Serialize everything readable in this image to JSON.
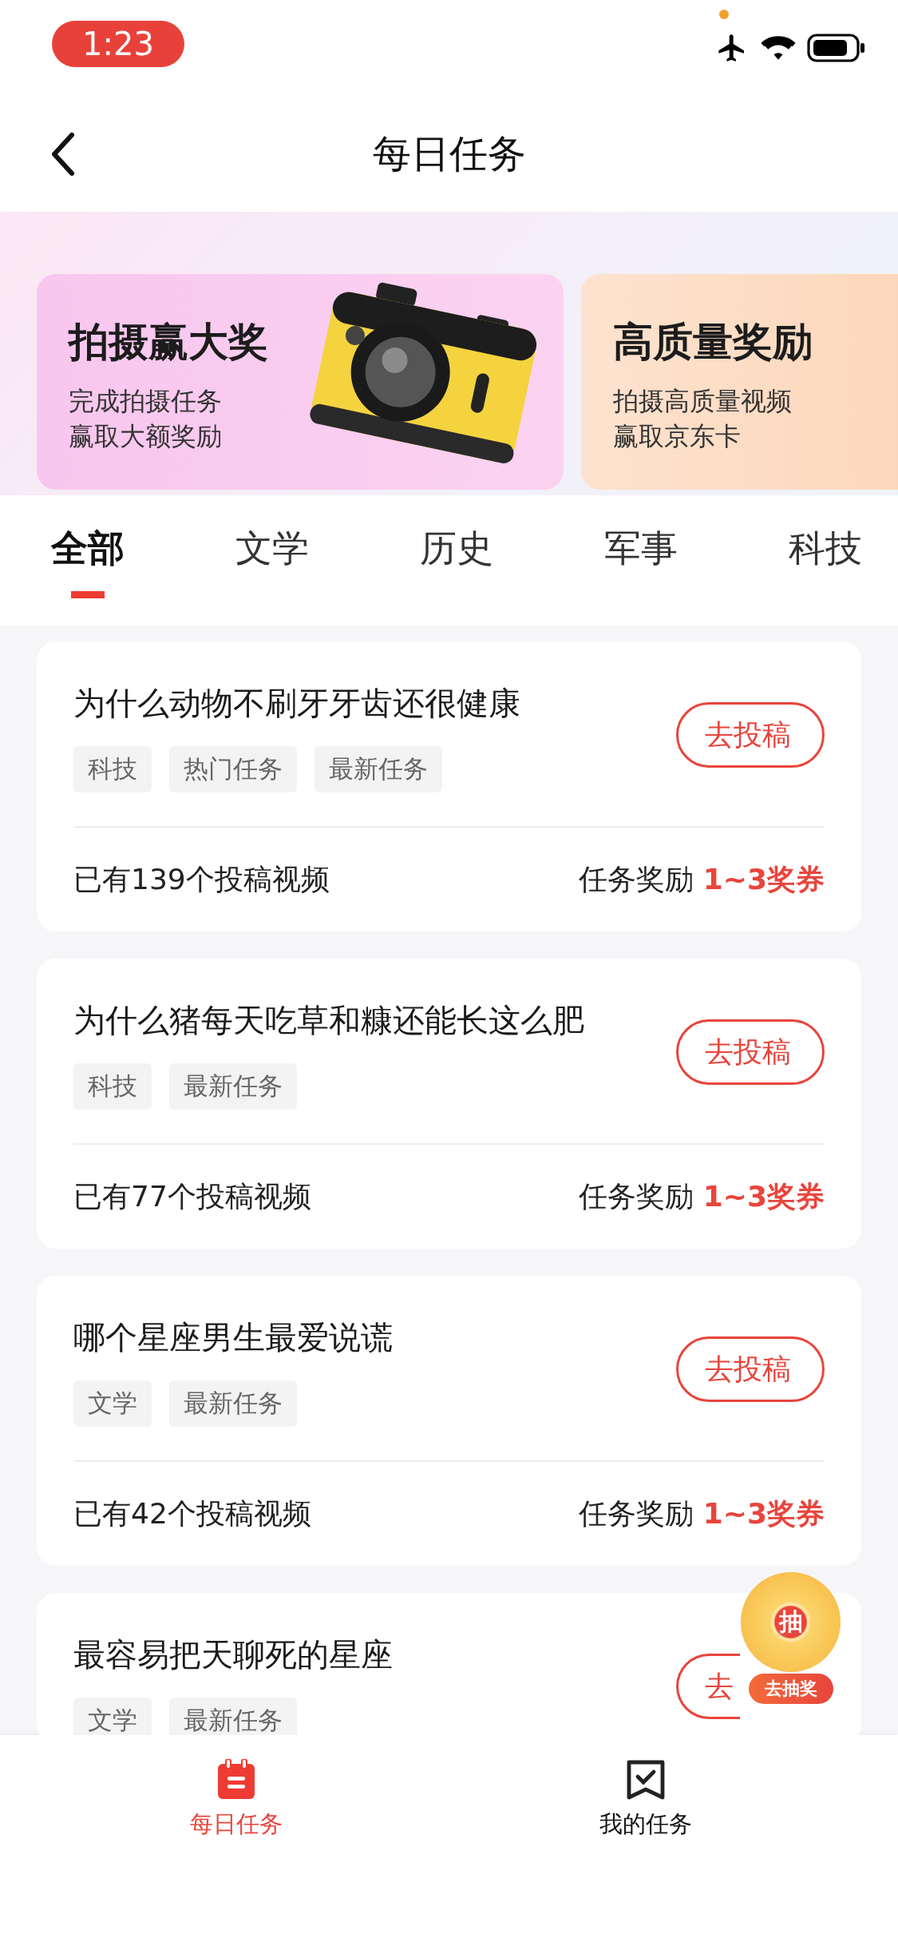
{
  "status_bar": {
    "time": "1:23"
  },
  "header": {
    "title": "每日任务"
  },
  "banners": [
    {
      "kind": "camera",
      "title": "拍摄赢大奖",
      "lines": [
        "完成拍摄任务",
        "赢取大额奖励"
      ]
    },
    {
      "kind": "card",
      "title": "高质量奖励",
      "lines": [
        "拍摄高质量视频",
        "赢取京东卡"
      ]
    }
  ],
  "tabs": [
    {
      "label": "全部",
      "selected": true
    },
    {
      "label": "文学",
      "selected": false
    },
    {
      "label": "历史",
      "selected": false
    },
    {
      "label": "军事",
      "selected": false
    },
    {
      "label": "科技",
      "selected": false
    }
  ],
  "tasks": [
    {
      "title": "为什么动物不刷牙牙齿还很健康",
      "tags": [
        "科技",
        "热门任务",
        "最新任务"
      ],
      "button": "去投稿",
      "count": "已有139个投稿视频",
      "reward": "任务奖励 **1~3奖券**"
    },
    {
      "title": "为什么猪每天吃草和糠还能长这么肥",
      "tags": [
        "科技",
        "最新任务"
      ],
      "button": "去投稿",
      "count": "已有77个投稿视频",
      "reward": "任务奖励 **1~3奖券**"
    },
    {
      "title": "哪个星座男生最爱说谎",
      "tags": [
        "文学",
        "最新任务"
      ],
      "button": "去投稿",
      "count": "已有42个投稿视频",
      "reward": "任务奖励 **1~3奖券**"
    },
    {
      "title": "最容易把天聊死的星座",
      "tags": [
        "文学",
        "最新任务"
      ],
      "button": "去"
    }
  ],
  "lottery": {
    "center": "抽",
    "label": "去抽奖"
  },
  "bottom_nav": [
    {
      "label": "每日任务",
      "kind": "calendar",
      "selected": true
    },
    {
      "label": "我的任务",
      "kind": "check",
      "selected": false
    }
  ]
}
